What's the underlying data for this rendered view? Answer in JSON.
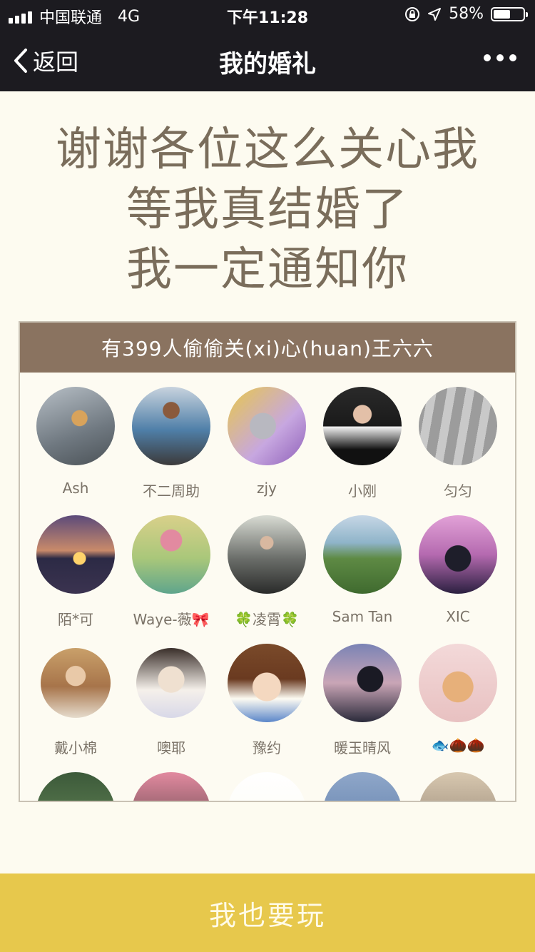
{
  "status_bar": {
    "carrier": "中国联通",
    "network": "4G",
    "time": "下午11:28",
    "battery": "58%",
    "battery_level": 0.58
  },
  "nav": {
    "back_label": "返回",
    "title": "我的婚礼"
  },
  "headline": {
    "lines": [
      "谢谢各位这么关心我",
      "等我真结婚了",
      "我一定通知你"
    ]
  },
  "panel": {
    "header": "有399人偷偷关(xi)心(huan)王六六",
    "users": [
      {
        "name": "Ash"
      },
      {
        "name": "不二周助"
      },
      {
        "name": "zjy"
      },
      {
        "name": "小刚"
      },
      {
        "name": "匀匀"
      },
      {
        "name": "陌*可"
      },
      {
        "name": "Waye-薇🎀"
      },
      {
        "name": "🍀凌霄🍀"
      },
      {
        "name": "Sam Tan"
      },
      {
        "name": "XIC"
      },
      {
        "name": "戴小棉"
      },
      {
        "name": "噢耶"
      },
      {
        "name": "豫约"
      },
      {
        "name": "暖玉晴风"
      },
      {
        "name": "🐟🌰🌰"
      }
    ]
  },
  "cta": {
    "label": "我也要玩"
  },
  "colors": {
    "bar_bg": "#1c1b20",
    "page_bg": "#fdfbf0",
    "headline_text": "#7a6d5b",
    "panel_header_bg": "#8a7360",
    "cta_bg": "#e7c84c"
  }
}
